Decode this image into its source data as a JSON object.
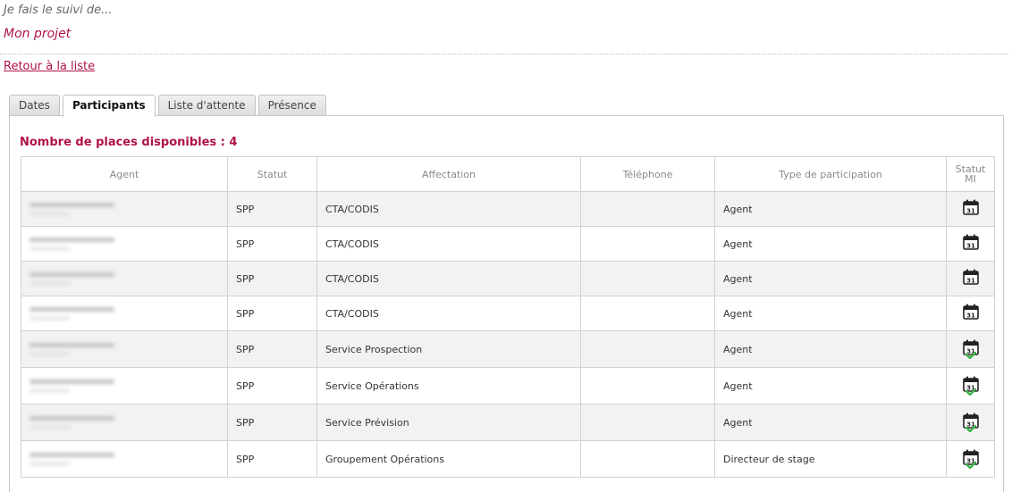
{
  "header": {
    "subtitle": "Je fais le suivi de...",
    "title": "Mon projet",
    "back_link": "Retour à la liste"
  },
  "tabs": [
    {
      "label": "Dates",
      "active": false
    },
    {
      "label": "Participants",
      "active": true
    },
    {
      "label": "Liste d'attente",
      "active": false
    },
    {
      "label": "Présence",
      "active": false
    }
  ],
  "panel": {
    "places_label": "Nombre de places disponibles : 4"
  },
  "table": {
    "columns": [
      "Agent",
      "Statut",
      "Affectation",
      "Téléphone",
      "Type de participation",
      "Statut MI"
    ],
    "rows": [
      {
        "statut": "SPP",
        "affectation": "CTA/CODIS",
        "telephone": "",
        "type": "Agent",
        "mi_icon": "calendar-icon",
        "mi_validated": false
      },
      {
        "statut": "SPP",
        "affectation": "CTA/CODIS",
        "telephone": "",
        "type": "Agent",
        "mi_icon": "calendar-icon",
        "mi_validated": false
      },
      {
        "statut": "SPP",
        "affectation": "CTA/CODIS",
        "telephone": "",
        "type": "Agent",
        "mi_icon": "calendar-icon",
        "mi_validated": false
      },
      {
        "statut": "SPP",
        "affectation": "CTA/CODIS",
        "telephone": "",
        "type": "Agent",
        "mi_icon": "calendar-icon",
        "mi_validated": false
      },
      {
        "statut": "SPP",
        "affectation": "Service Prospection",
        "telephone": "",
        "type": "Agent",
        "mi_icon": "calendar-check-icon",
        "mi_validated": true
      },
      {
        "statut": "SPP",
        "affectation": "Service Opérations",
        "telephone": "",
        "type": "Agent",
        "mi_icon": "calendar-check-icon",
        "mi_validated": true
      },
      {
        "statut": "SPP",
        "affectation": "Service Prévision",
        "telephone": "",
        "type": "Agent",
        "mi_icon": "calendar-check-icon",
        "mi_validated": true
      },
      {
        "statut": "SPP",
        "affectation": "Groupement Opérations",
        "telephone": "",
        "type": "Directeur de stage",
        "mi_icon": "calendar-check-icon",
        "mi_validated": true
      }
    ],
    "calendar_day": "31"
  },
  "colors": {
    "accent": "#b0124a",
    "check": "#3bb54a"
  }
}
